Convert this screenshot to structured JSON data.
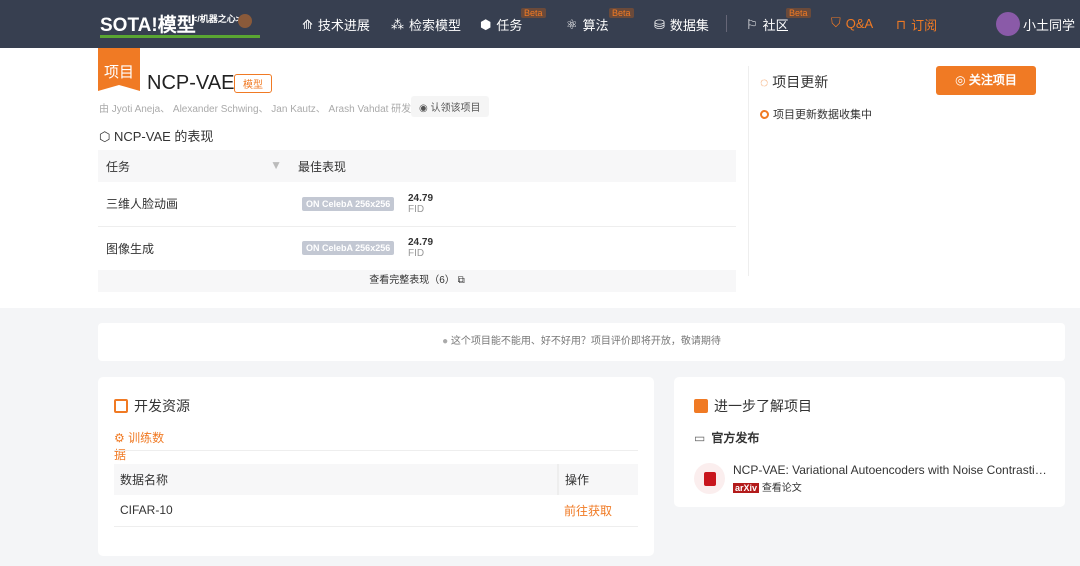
{
  "nav": {
    "logo": "SOTA!模型",
    "logo_sub": "</机器之心>",
    "items": [
      {
        "label": "技术进展"
      },
      {
        "label": "检索模型"
      },
      {
        "label": "任务",
        "beta": "Beta"
      },
      {
        "label": "算法",
        "beta": "Beta"
      },
      {
        "label": "数据集"
      },
      {
        "label": "社区",
        "beta": "Beta"
      },
      {
        "label": "Q&A"
      },
      {
        "label": "订阅"
      }
    ],
    "user": "小土同学"
  },
  "project": {
    "badge": "项目",
    "title": "NCP-VAE",
    "tag": "模型",
    "authors": "由 Jyoti Aneja、 Alexander Schwing、 Jan Kautz、 Arash Vahdat 研发",
    "claim": "认领该项目",
    "perf_title": "NCP-VAE 的表现",
    "table": {
      "headers": [
        "任务",
        "最佳表现"
      ],
      "rows": [
        {
          "task": "三维人脸动画",
          "dataset": "ON CelebA 256x256",
          "value": "24.79",
          "metric": "FID"
        },
        {
          "task": "图像生成",
          "dataset": "ON CelebA 256x256",
          "value": "24.79",
          "metric": "FID"
        }
      ],
      "more": "查看完整表现（6）"
    }
  },
  "updates": {
    "title": "项目更新",
    "follow": "关注项目",
    "item": "项目更新数据收集中"
  },
  "eval": "这个项目能不能用、好不好用？项目评价即将开放，敬请期待",
  "resources": {
    "title": "开发资源",
    "tab": "训练数据",
    "headers": [
      "数据名称",
      "操作"
    ],
    "rows": [
      {
        "name": "CIFAR-10",
        "action": "前往获取"
      }
    ]
  },
  "learn": {
    "title": "进一步了解项目",
    "section": "官方发布",
    "paper": "NCP-VAE: Variational Autoencoders with Noise Contrasti…",
    "source": "arXiv",
    "link": "查看论文"
  },
  "colors": {
    "accent": "#f07a24",
    "nav": "#373f50"
  }
}
